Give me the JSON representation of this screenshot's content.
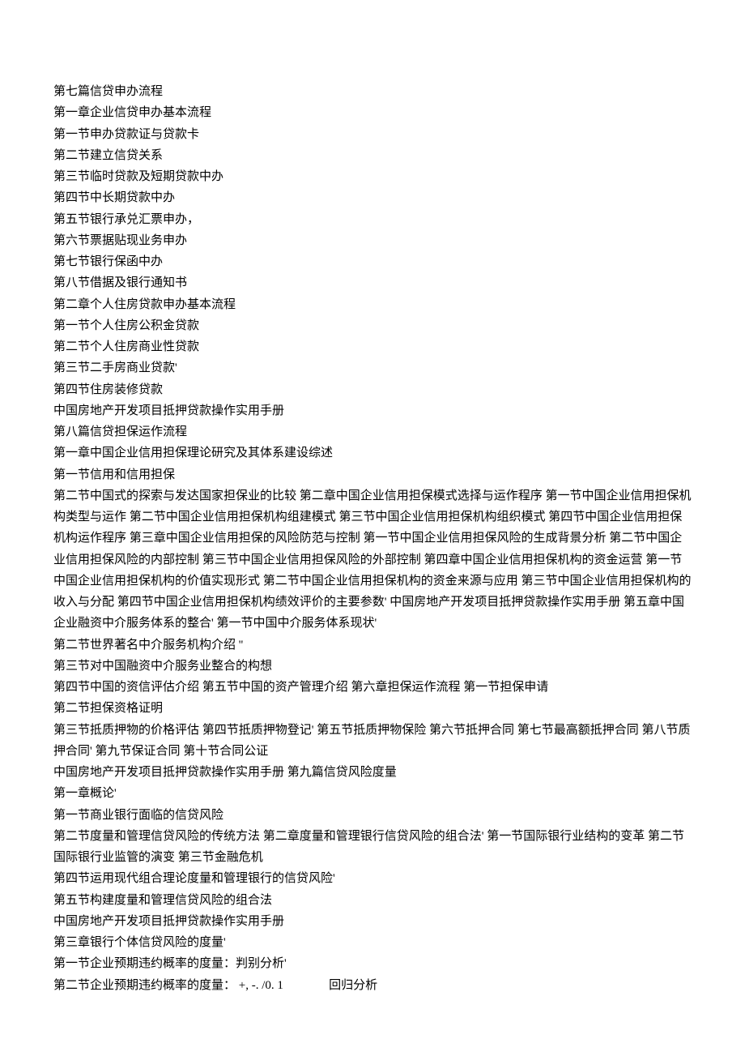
{
  "lines": [
    "第七篇信贷申办流程",
    "第一章企业信贷申办基本流程",
    "第一节申办贷款证与贷款卡",
    "第二节建立信贷关系",
    "第三节临时贷款及短期贷款中办",
    "第四节中长期贷款中办",
    "第五节银行承兑汇票申办，",
    "第六节票据贴现业务申办",
    "第七节银行保函中办",
    "第八节借据及银行通知书",
    "第二章个人住房贷款申办基本流程",
    "第一节个人住房公积金贷款",
    "第二节个人住房商业性贷款",
    "第三节二手房商业贷款'",
    "第四节住房装修贷款",
    "中国房地产开发项目抵押贷款操作实用手册",
    "第八篇信贷担保运作流程",
    "第一章中国企业信用担保理论研究及其体系建设综述",
    "第一节信用和信用担保",
    "第二节中国式的探索与发达国家担保业的比较 第二章中国企业信用担保模式选择与运作程序 第一节中国企业信用担保机构类型与运作 第二节中国企业信用担保机构组建模式 第三节中国企业信用担保机构组织模式 第四节中国企业信用担保机构运作程序 第三章中国企业信用担保的风险防范与控制  第一节中国企业信用担保风险的生成背景分析  第二节中国企业信用担保风险的内部控制 第三节中国企业信用担保风险的外部控制 第四章中国企业信用担保机构的资金运营 第一节中国企业信用担保机构的价值实现形式 第二节中国企业信用担保机构的资金来源与应用 第三节中国企业信用担保机构的收入与分配 第四节中国企业信用担保机构绩效评价的主要参数'  中国房地产开发项目抵押贷款操作实用手册  第五章中国企业融资中介服务体系的整合'  第一节中国中介服务体系现状'",
    "第二节世界著名中介服务机构介绍 ''",
    "第三节对中国融资中介服务业整合的构想",
    "第四节中国的资信评估介绍 第五节中国的资产管理介绍 第六章担保运作流程 第一节担保申请",
    "第二节担保资格证明",
    "第三节抵质押物的价格评估 第四节抵质押物登记'  第五节抵质押物保险 第六节抵押合同 第七节最高额抵押合同 第八节质押合同'  第九节保证合同 第十节合同公证",
    "中国房地产开发项目抵押贷款操作实用手册 第九篇信贷风险度量",
    "第一章概论'",
    "第一节商业银行面临的信贷风险",
    "第二节度量和管理信贷风险的传统方法  第二章度量和管理银行信贷风险的组合法'  第一节国际银行业结构的变革  第二节国际银行业监管的演变 第三节金融危机",
    "第四节运用现代组合理论度量和管理银行的信贷风险'",
    "第五节构建度量和管理信贷风险的组合法",
    "中国房地产开发项目抵押贷款操作实用手册",
    "第三章银行个体信贷风险的度量'",
    "第一节企业预期违约概率的度量：判别分析'",
    "第二节企业预期违约概率的度量： +, -. /0. 1               回归分析"
  ]
}
